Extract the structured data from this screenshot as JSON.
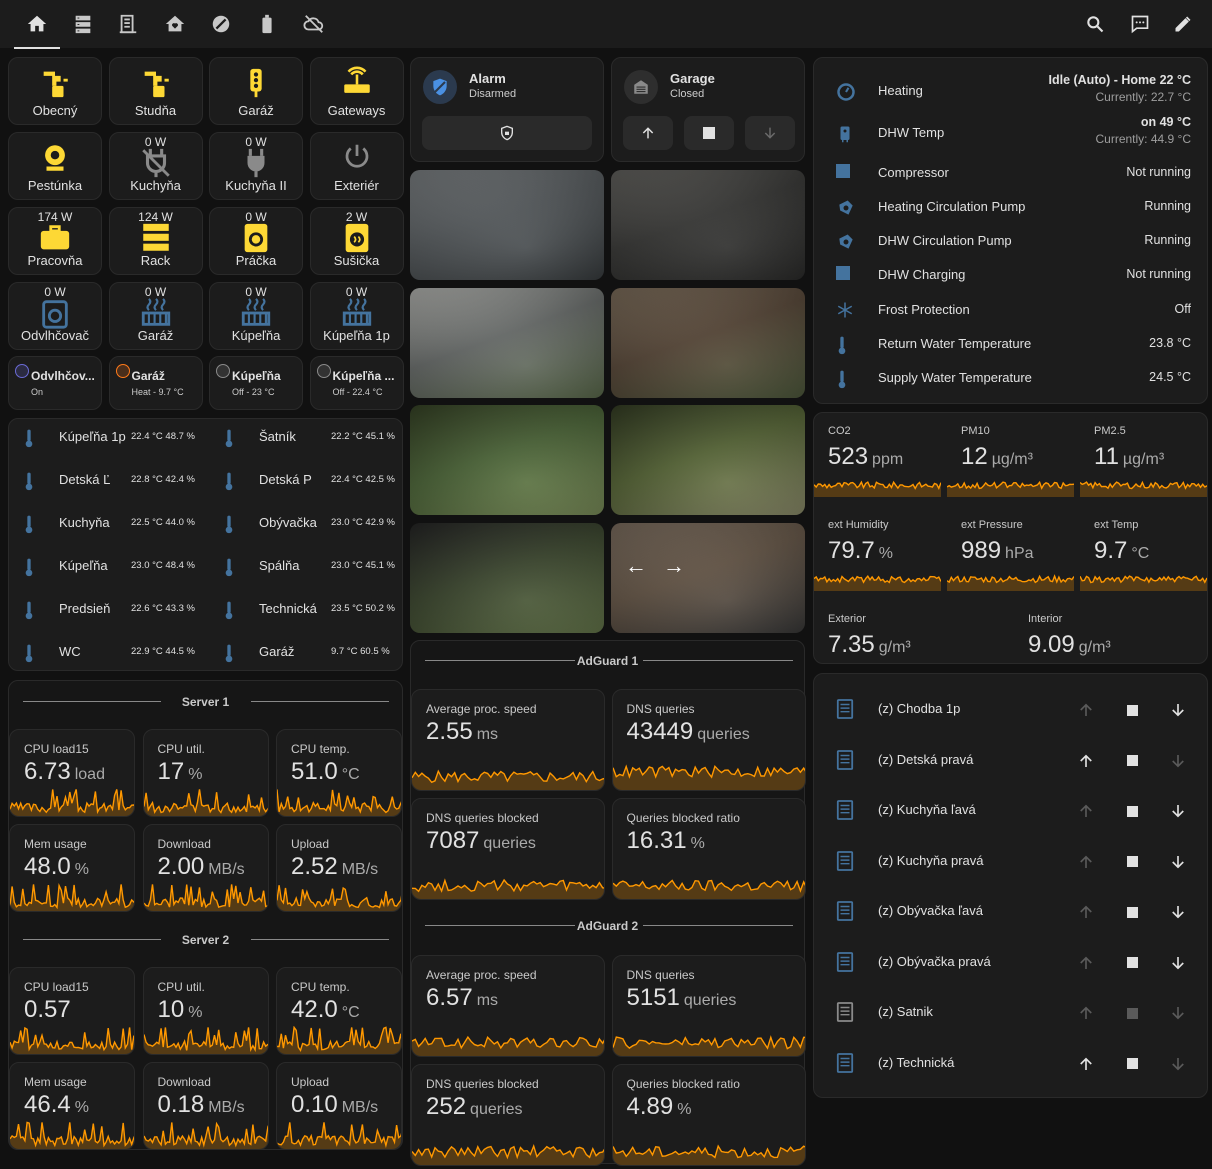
{
  "nav": {
    "tabs": [
      {
        "icon": "home-icon",
        "active": true
      },
      {
        "icon": "server-icon"
      },
      {
        "icon": "building-icon"
      },
      {
        "icon": "home-heart-icon"
      },
      {
        "icon": "gauge-icon"
      },
      {
        "icon": "battery-icon"
      },
      {
        "icon": "cloud-off-icon"
      }
    ],
    "actions": [
      "search-icon",
      "chat-icon",
      "edit-icon"
    ]
  },
  "tiles": [
    {
      "label": "Obecný",
      "power": "",
      "icon": "water-pump-icon"
    },
    {
      "label": "Studňa",
      "power": "",
      "icon": "water-pump-icon"
    },
    {
      "label": "Garáž",
      "power": "",
      "icon": "traffic-light-icon"
    },
    {
      "label": "Gateways",
      "power": "",
      "icon": "router-icon"
    },
    {
      "label": "Pestúnka",
      "power": "",
      "icon": "webcam-icon"
    },
    {
      "label": "Kuchyňa",
      "power": "0 W",
      "icon": "power-plug-off-icon"
    },
    {
      "label": "Kuchyňa II",
      "power": "0 W",
      "icon": "power-plug-icon"
    },
    {
      "label": "Exteriér",
      "power": "",
      "icon": "power-icon"
    },
    {
      "label": "Pracovňa",
      "power": "174 W",
      "icon": "briefcase-icon"
    },
    {
      "label": "Rack",
      "power": "124 W",
      "icon": "server-rack-icon"
    },
    {
      "label": "Práčka",
      "power": "0 W",
      "icon": "washing-machine-icon"
    },
    {
      "label": "Sušička",
      "power": "2 W",
      "icon": "tumble-dryer-icon"
    },
    {
      "label": "Odvlhčovač",
      "power": "0 W",
      "icon": "dehumidifier-icon"
    },
    {
      "label": "Garáž",
      "power": "0 W",
      "icon": "radiator-icon"
    },
    {
      "label": "Kúpeľňa",
      "power": "0 W",
      "icon": "radiator-icon"
    },
    {
      "label": "Kúpeľňa 1p",
      "power": "0 W",
      "icon": "radiator-icon"
    }
  ],
  "chips": [
    {
      "title": "Odvlhčov...",
      "sub": "On",
      "color": "#6b6bd6"
    },
    {
      "title": "Garáž",
      "sub": "Heat - 9.7 °C",
      "color": "#ff7a1a"
    },
    {
      "title": "Kúpeľňa",
      "sub": "Off - 23 °C",
      "color": "#8a8a8a"
    },
    {
      "title": "Kúpeľňa ...",
      "sub": "Off - 22.4 °C",
      "color": "#8a8a8a"
    }
  ],
  "climate": [
    {
      "name": "Kúpeľňa 1p",
      "val": "22.4 °C 48.7 %"
    },
    {
      "name": "Šatník",
      "val": "22.2 °C 45.1 %"
    },
    {
      "name": "Detská Ľ",
      "val": "22.8 °C 42.4 %"
    },
    {
      "name": "Detská P",
      "val": "22.4 °C 42.5 %"
    },
    {
      "name": "Kuchyňa",
      "val": "22.5 °C 44.0 %"
    },
    {
      "name": "Obývačka",
      "val": "23.0 °C 42.9 %"
    },
    {
      "name": "Kúpeľňa",
      "val": "23.0 °C 48.4 %"
    },
    {
      "name": "Spálňa",
      "val": "23.0 °C 45.1 %"
    },
    {
      "name": "Predsieň",
      "val": "22.6 °C 43.3 %"
    },
    {
      "name": "Technická",
      "val": "23.5 °C 50.2 %"
    },
    {
      "name": "WC",
      "val": "22.9 °C 44.5 %"
    },
    {
      "name": "Garáž",
      "val": "9.7 °C 60.5 %"
    }
  ],
  "server1": {
    "title": "Server 1",
    "stats": [
      {
        "label": "CPU load15",
        "value": "6.73",
        "unit": "load"
      },
      {
        "label": "CPU util.",
        "value": "17",
        "unit": "%"
      },
      {
        "label": "CPU temp.",
        "value": "51.0",
        "unit": "°C"
      },
      {
        "label": "Mem usage",
        "value": "48.0",
        "unit": "%"
      },
      {
        "label": "Download",
        "value": "2.00",
        "unit": "MB/s"
      },
      {
        "label": "Upload",
        "value": "2.52",
        "unit": "MB/s"
      }
    ]
  },
  "server2": {
    "title": "Server 2",
    "stats": [
      {
        "label": "CPU load15",
        "value": "0.57",
        "unit": ""
      },
      {
        "label": "CPU util.",
        "value": "10",
        "unit": "%"
      },
      {
        "label": "CPU temp.",
        "value": "42.0",
        "unit": "°C"
      },
      {
        "label": "Mem usage",
        "value": "46.4",
        "unit": "%"
      },
      {
        "label": "Download",
        "value": "0.18",
        "unit": "MB/s"
      },
      {
        "label": "Upload",
        "value": "0.10",
        "unit": "MB/s"
      }
    ]
  },
  "alarm": {
    "title": "Alarm",
    "state": "Disarmed"
  },
  "garage": {
    "title": "Garage",
    "state": "Closed"
  },
  "adguard1": {
    "title": "AdGuard 1",
    "stats": [
      {
        "label": "Average proc. speed",
        "value": "2.55",
        "unit": "ms"
      },
      {
        "label": "DNS queries",
        "value": "43449",
        "unit": "queries"
      },
      {
        "label": "DNS queries blocked",
        "value": "7087",
        "unit": "queries"
      },
      {
        "label": "Queries blocked ratio",
        "value": "16.31",
        "unit": "%"
      }
    ]
  },
  "adguard2": {
    "title": "AdGuard 2",
    "stats": [
      {
        "label": "Average proc. speed",
        "value": "6.57",
        "unit": "ms"
      },
      {
        "label": "DNS queries",
        "value": "5151",
        "unit": "queries"
      },
      {
        "label": "DNS queries blocked",
        "value": "252",
        "unit": "queries"
      },
      {
        "label": "Queries blocked ratio",
        "value": "4.89",
        "unit": "%"
      }
    ]
  },
  "heating": [
    {
      "name": "Heating",
      "state": "Idle (Auto) - Home 22 °C",
      "sub": "Currently: 22.7 °C",
      "icon": "thermostat-icon"
    },
    {
      "name": "DHW Temp",
      "state": "on 49 °C",
      "sub": "Currently: 44.9 °C",
      "icon": "water-boiler-icon"
    },
    {
      "name": "Compressor",
      "state": "Not running",
      "sub": "",
      "icon": "square-icon"
    },
    {
      "name": "Heating Circulation Pump",
      "state": "Running",
      "sub": "",
      "icon": "pump-icon"
    },
    {
      "name": "DHW Circulation Pump",
      "state": "Running",
      "sub": "",
      "icon": "pump-icon"
    },
    {
      "name": "DHW Charging",
      "state": "Not running",
      "sub": "",
      "icon": "square-icon"
    },
    {
      "name": "Frost Protection",
      "state": "Off",
      "sub": "",
      "icon": "snowflake-icon"
    },
    {
      "name": "Return Water Temperature",
      "state": "23.8 °C",
      "sub": "",
      "icon": "thermometer-icon"
    },
    {
      "name": "Supply Water Temperature",
      "state": "24.5 °C",
      "sub": "",
      "icon": "thermometer-icon"
    }
  ],
  "air": [
    {
      "label": "CO2",
      "value": "523",
      "unit": "ppm"
    },
    {
      "label": "PM10",
      "value": "12",
      "unit": "µg/m³"
    },
    {
      "label": "PM2.5",
      "value": "11",
      "unit": "µg/m³"
    },
    {
      "label": "ext Humidity",
      "value": "79.7",
      "unit": "%"
    },
    {
      "label": "ext Pressure",
      "value": "989",
      "unit": "hPa"
    },
    {
      "label": "ext Temp",
      "value": "9.7",
      "unit": "°C"
    },
    {
      "label": "Exterior",
      "value": "7.35",
      "unit": "g/m³"
    },
    {
      "label": "Interior",
      "value": "9.09",
      "unit": "g/m³"
    }
  ],
  "covers": [
    {
      "name": "(z) Chodba 1p",
      "up": false,
      "stop": true,
      "down": true
    },
    {
      "name": "(z) Detská pravá",
      "up": true,
      "stop": true,
      "down": false
    },
    {
      "name": "(z) Kuchyňa ľavá",
      "up": false,
      "stop": true,
      "down": true
    },
    {
      "name": "(z) Kuchyňa pravá",
      "up": false,
      "stop": true,
      "down": true
    },
    {
      "name": "(z) Obývačka ľavá",
      "up": false,
      "stop": true,
      "down": true
    },
    {
      "name": "(z) Obývačka pravá",
      "up": false,
      "stop": true,
      "down": true
    },
    {
      "name": "(z) Satnik",
      "up": false,
      "stop": false,
      "down": false
    },
    {
      "name": "(z) Technická",
      "up": true,
      "stop": true,
      "down": false
    }
  ],
  "colors": {
    "accent": "#fdd835",
    "graph": "#ff9800",
    "blue": "#44739e",
    "cardBg": "#1c1c1c"
  }
}
